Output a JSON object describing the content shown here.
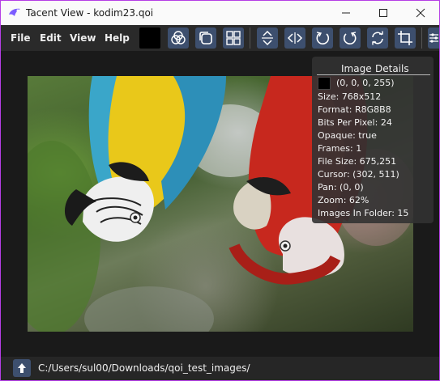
{
  "window": {
    "title": "Tacent View - kodim23.qoi",
    "frame_color": "#b53ee6"
  },
  "menu": {
    "items": [
      {
        "label": "File"
      },
      {
        "label": "Edit"
      },
      {
        "label": "View"
      },
      {
        "label": "Help"
      }
    ]
  },
  "toolbar": {
    "current_color": "#000000",
    "buttons": [
      {
        "icon": "channels-icon"
      },
      {
        "icon": "square-icon"
      },
      {
        "icon": "grid-icon"
      },
      {
        "icon": "flip-vertical-icon"
      },
      {
        "icon": "flip-horizontal-icon"
      },
      {
        "icon": "rotate-left-icon"
      },
      {
        "icon": "rotate-right-icon"
      },
      {
        "icon": "refresh-icon"
      },
      {
        "icon": "crop-icon"
      },
      {
        "icon": "adjust-icon"
      }
    ],
    "accent_color": "#3d4f6e"
  },
  "overlay": {
    "tabs": [
      "Image",
      "Details"
    ],
    "color_value": "(0, 0, 0, 255)",
    "rows": [
      "Size: 768x512",
      "Format: R8G8B8",
      "Bits Per Pixel: 24",
      "Opaque: true",
      "Frames: 1",
      "File Size: 675,251",
      "Cursor: (302, 511)",
      "Pan: (0, 0)",
      "Zoom: 62%",
      "Images In Folder: 15"
    ]
  },
  "status": {
    "path": "C:/Users/sul00/Downloads/qoi_test_images/"
  }
}
